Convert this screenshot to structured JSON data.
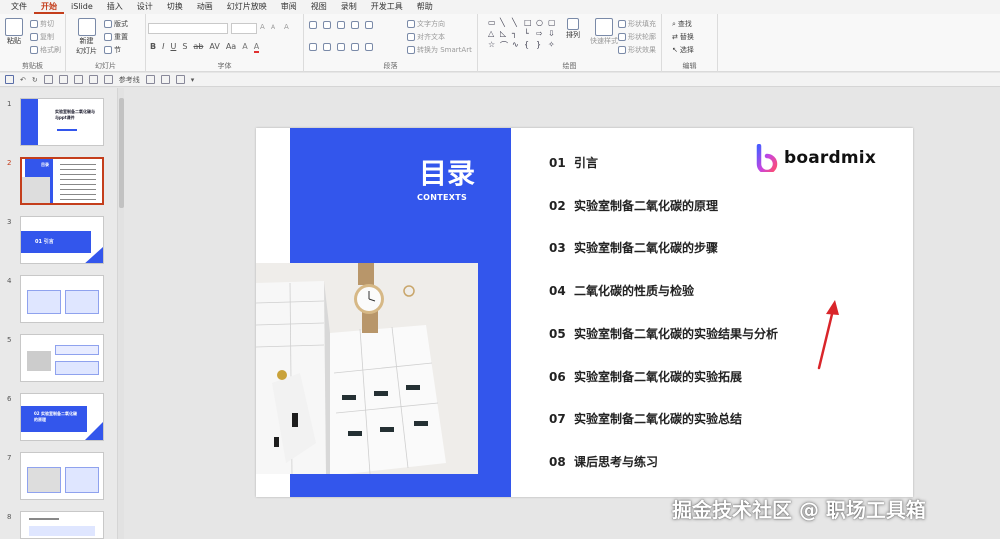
{
  "menu": [
    "文件",
    "开始",
    "iSlide",
    "插入",
    "设计",
    "切换",
    "动画",
    "幻灯片放映",
    "审阅",
    "视图",
    "录制",
    "开发工具",
    "帮助"
  ],
  "menu_active": 1,
  "ribbon": {
    "clipboard": {
      "paste": "粘贴",
      "cut": "剪切",
      "copy": "复制",
      "format_painter": "格式刷",
      "label": "剪贴板"
    },
    "slides": {
      "new_slide": "新建",
      "new_slide2": "幻灯片",
      "layout": "版式",
      "reset": "重置",
      "section": "节",
      "label": "幻灯片"
    },
    "font": {
      "bold": "B",
      "italic": "I",
      "underline": "U",
      "shadow": "S",
      "strike": "ab",
      "spacing": "AV",
      "case": "Aa",
      "grow": "A",
      "shrink": "A",
      "clear": "A",
      "color": "A",
      "highlight": "A",
      "label": "字体"
    },
    "paragraph": {
      "text_direction": "文字方向",
      "align_text": "对齐文本",
      "smartart": "转换为 SmartArt",
      "label": "段落"
    },
    "drawing": {
      "arrange": "排列",
      "quick_styles": "快速样式",
      "shape_fill": "形状填充",
      "shape_outline": "形状轮廓",
      "shape_effects": "形状效果",
      "label": "绘图"
    },
    "editing": {
      "find": "查找",
      "replace": "替换",
      "select": "选择",
      "label": "编辑"
    }
  },
  "qat": {
    "reference_line": "参考线"
  },
  "thumbnails": [
    "1",
    "2",
    "3",
    "4",
    "5",
    "6",
    "7",
    "8"
  ],
  "thumbnail_selected": 1,
  "thumb_texts": {
    "t1_title": "实验室制备二氧化碳与与ppt课件",
    "t2_title": "目录",
    "t3_title": "01 引言",
    "t6_title": "02 实验室制备二氧化碳的原理"
  },
  "slide": {
    "title": "目录",
    "subtitle": "CONTEXTS",
    "toc": [
      {
        "num": "01",
        "text": "引言"
      },
      {
        "num": "02",
        "text": "实验室制备二氧化碳的原理"
      },
      {
        "num": "03",
        "text": "实验室制备二氧化碳的步骤"
      },
      {
        "num": "04",
        "text": "二氧化碳的性质与检验"
      },
      {
        "num": "05",
        "text": "实验室制备二氧化碳的实验结果与分析"
      },
      {
        "num": "06",
        "text": "实验室制备二氧化碳的实验拓展"
      },
      {
        "num": "07",
        "text": "实验室制备二氧化碳的实验总结"
      },
      {
        "num": "08",
        "text": "课后思考与练习"
      }
    ],
    "logo_text": "boardmix"
  },
  "watermark": "掘金技术社区 @ 职场工具箱",
  "colors": {
    "accent_blue": "#3356ec",
    "ribbon_active": "#c43e1c",
    "arrow_red": "#d9252a"
  }
}
